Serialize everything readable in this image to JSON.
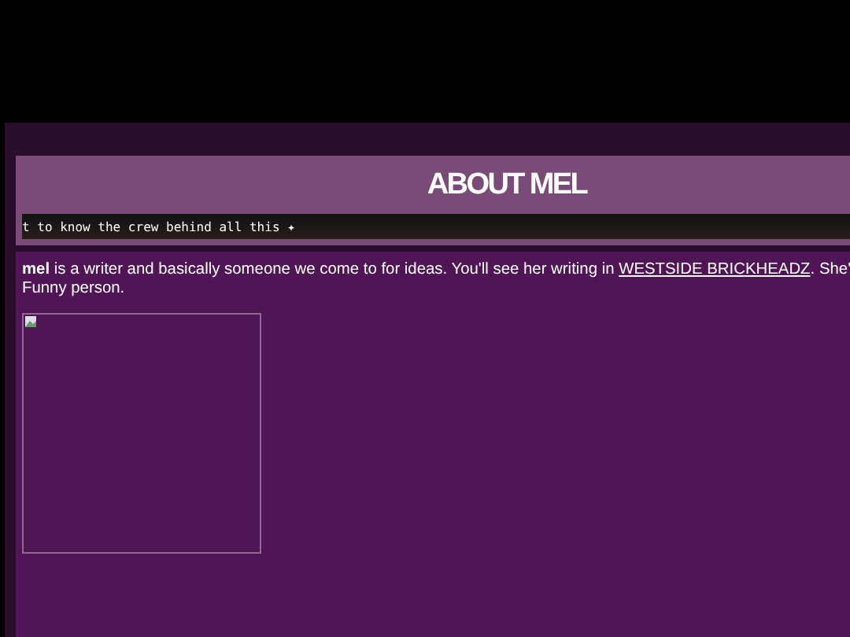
{
  "header": {
    "title": "ABOUT MEL",
    "marquee": "t to know the crew behind all this ✦"
  },
  "bio": {
    "text": "**mel** is a writer and basically someone we come to for ideas. You'll see her writing in ",
    "link": "WESTSIDE BRICKHEADZ",
    "after": ". She'",
    "line2": "Funny person."
  },
  "image": {
    "kind": "broken"
  }
}
